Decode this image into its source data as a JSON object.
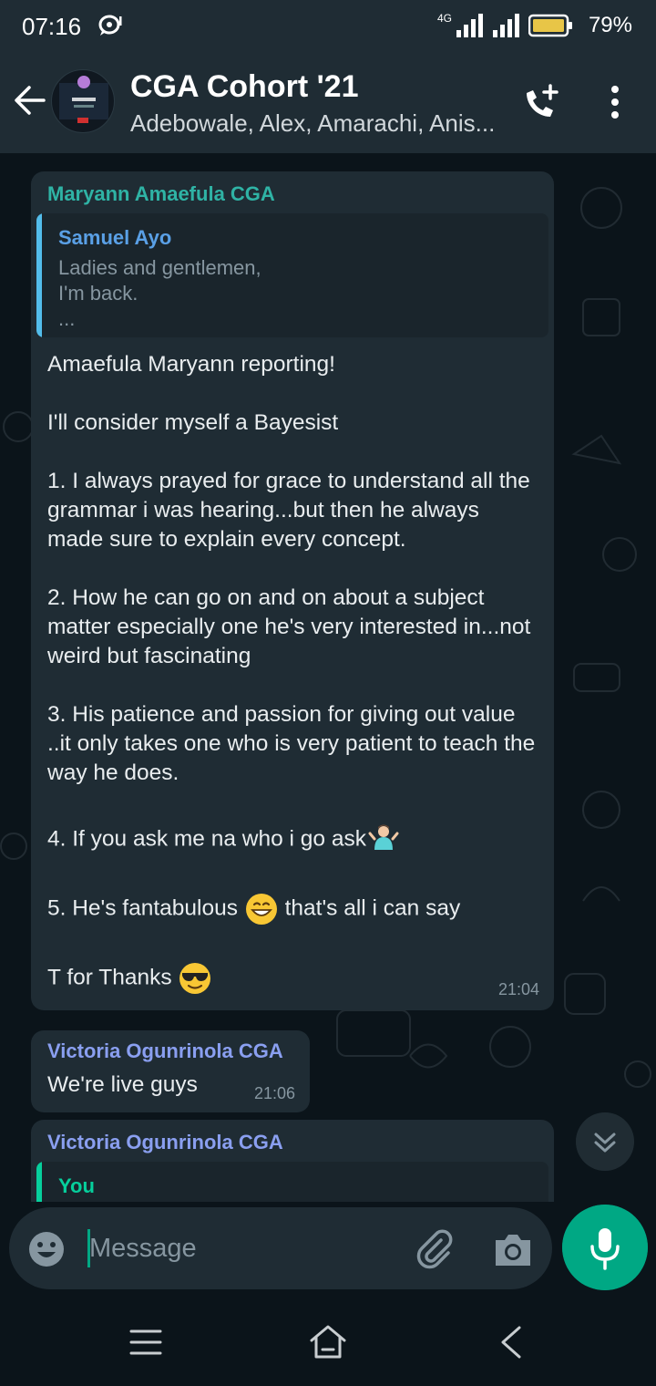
{
  "status_bar": {
    "time": "07:16",
    "network": "4G",
    "battery": "79%"
  },
  "header": {
    "title": "CGA Cohort '21",
    "subtitle": "Adebowale, Alex, Amarachi, Anis..."
  },
  "messages": [
    {
      "sender": "Maryann Amaefula CGA",
      "quote": {
        "name": "Samuel Ayo",
        "text": "Ladies and gentlemen,\nI'm back.\n..."
      },
      "lines": [
        "Amaefula Maryann reporting!",
        "I'll consider myself a Bayesist",
        "1. I always prayed for grace to understand all the grammar i was hearing...but then he always made sure to explain every concept.",
        "2. How he can go on and on about a subject matter especially one he's very interested in...not weird but fascinating",
        "3. His patience and passion for giving  out value ..it only takes one who is very patient to teach the way he does.",
        "4. If you ask me na who i go ask",
        "5. He's fantabulous",
        "that's all i can say",
        "T for Thanks"
      ],
      "time": "21:04"
    },
    {
      "sender": "Victoria Ogunrinola CGA",
      "text": "We're live guys",
      "time": "21:06"
    },
    {
      "sender": "Victoria Ogunrinola CGA",
      "quote": {
        "name": "You"
      }
    }
  ],
  "composer": {
    "placeholder": "Message"
  },
  "icons": {
    "back": "arrow-left-icon",
    "call": "add-call-icon",
    "menu": "more-vert-icon",
    "emoji": "emoji-icon",
    "attach": "paperclip-icon",
    "camera": "camera-icon",
    "mic": "mic-icon",
    "scroll": "double-chevron-down-icon"
  },
  "colors": {
    "accent": "#00a884",
    "bubble": "#1f2c34",
    "background": "#0b141a"
  }
}
